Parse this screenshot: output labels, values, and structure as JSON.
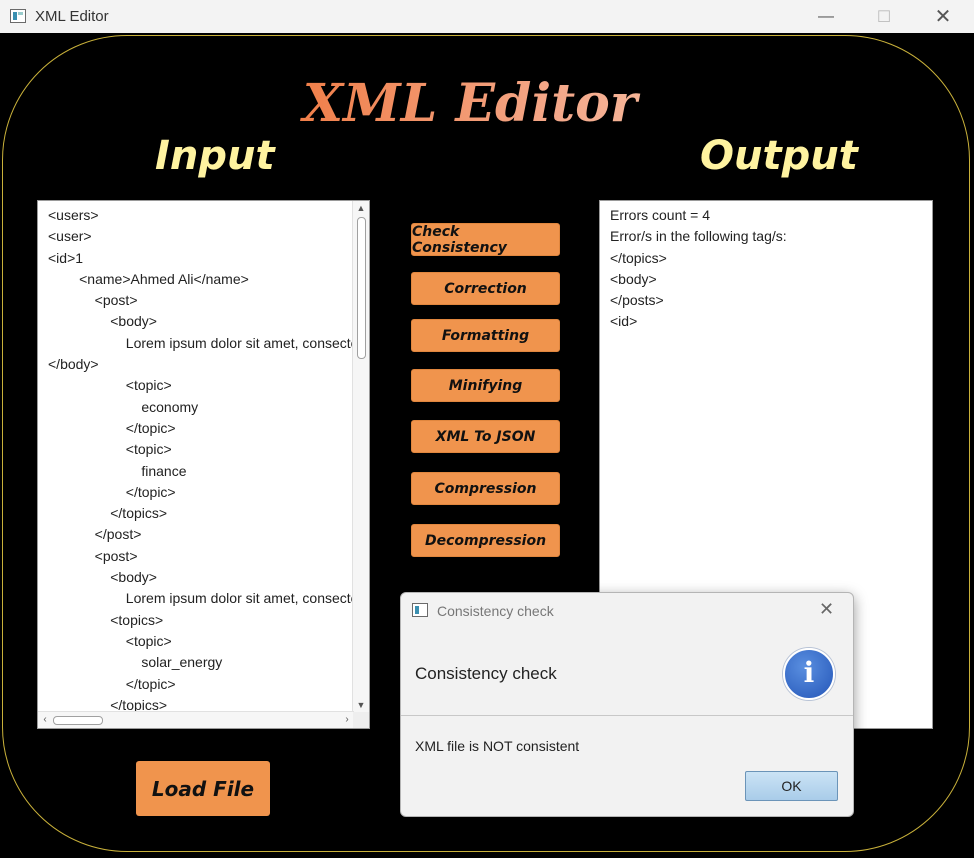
{
  "window": {
    "title": "XML Editor",
    "minimize": "—",
    "maximize": "☐",
    "close": "✕"
  },
  "app": {
    "title": "XML Editor",
    "input_label": "Input",
    "output_label": "Output"
  },
  "input": {
    "text": "<users>\n<user>\n<id>1\n        <name>Ahmed Ali</name>\n            <post>\n                <body>\n                    Lorem ipsum dolor sit amet, consectetur\n</body>\n                    <topic>\n                        economy\n                    </topic>\n                    <topic>\n                        finance\n                    </topic>\n                </topics>\n            </post>\n            <post>\n                <body>\n                    Lorem ipsum dolor sit amet, consectetur\n                <topics>\n                    <topic>\n                        solar_energy\n                    </topic>\n                </topics>"
  },
  "output": {
    "text": "Errors count = 4\nError/s in the following tag/s:\n</topics>\n<body>\n</posts>\n<id>"
  },
  "actions": [
    {
      "label": "Check Consistency"
    },
    {
      "label": "Correction"
    },
    {
      "label": "Formatting"
    },
    {
      "label": "Minifying"
    },
    {
      "label": "XML To JSON"
    },
    {
      "label": "Compression"
    },
    {
      "label": "Decompression"
    }
  ],
  "load_button": "Load File",
  "dialog": {
    "title": "Consistency check",
    "header": "Consistency check",
    "info_glyph": "i",
    "message": "XML file is NOT consistent",
    "ok_label": "OK",
    "close": "✕"
  },
  "colors": {
    "button": "#f0944d",
    "pane_title": "#fff3a0",
    "frame": "#c9b13a",
    "background": "#000000"
  }
}
